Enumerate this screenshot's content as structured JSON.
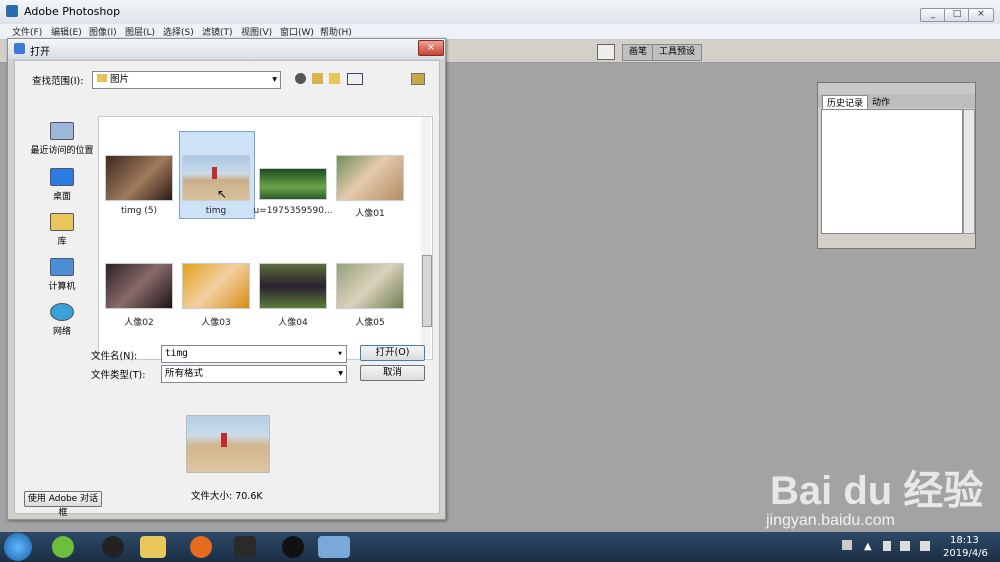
{
  "app": {
    "title": "Adobe Photoshop"
  },
  "menu": [
    "文件(F)",
    "编辑(E)",
    "图像(I)",
    "图层(L)",
    "选择(S)",
    "滤镜(T)",
    "视图(V)",
    "窗口(W)",
    "帮助(H)"
  ],
  "options_tabs": [
    "画笔",
    "工具预设"
  ],
  "history_panel": {
    "tab_active": "历史记录",
    "tab_other": "动作"
  },
  "dialog": {
    "title": "打开",
    "look_in_label": "查找范围(I):",
    "look_in_value": "图片",
    "places": [
      "最近访问的位置",
      "桌面",
      "库",
      "计算机",
      "网络"
    ],
    "files": [
      {
        "name": "timg (5)"
      },
      {
        "name": "timg",
        "selected": true
      },
      {
        "name": "u=1975359590..."
      },
      {
        "name": "人像01"
      },
      {
        "name": "人像02"
      },
      {
        "name": "人像03"
      },
      {
        "name": "人像04"
      },
      {
        "name": "人像05"
      }
    ],
    "filename_label": "文件名(N):",
    "filename_value": "timg",
    "filetype_label": "文件类型(T):",
    "filetype_value": "所有格式",
    "open_button": "打开(O)",
    "cancel_button": "取消",
    "adobe_dialog_button": "使用 Adobe 对话框",
    "file_size": "文件大小: 70.6K"
  },
  "taskbar": {
    "time": "18:13",
    "date": "2019/4/6"
  },
  "watermark": {
    "brand": "Bai du 经验",
    "url": "jingyan.baidu.com"
  }
}
